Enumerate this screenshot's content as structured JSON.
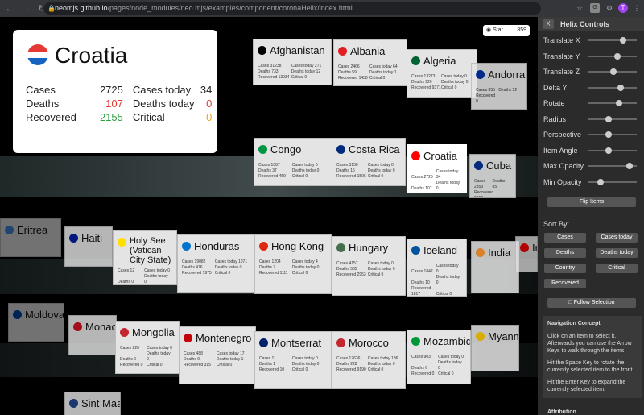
{
  "browser": {
    "host": "neomjs.github.io",
    "path": "/pages/node_modules/neo.mjs/examples/component/coronaHelix/index.html",
    "avatar": "T"
  },
  "github": {
    "label": "Star",
    "count": "859"
  },
  "selected": {
    "name": "Croatia",
    "cases_label": "Cases",
    "cases": "2725",
    "deaths_label": "Deaths",
    "deaths": "107",
    "recovered_label": "Recovered",
    "recovered": "2155",
    "cases_today_label": "Cases today",
    "cases_today": "34",
    "deaths_today_label": "Deaths today",
    "deaths_today": "0",
    "critical_label": "Critical",
    "critical": "0"
  },
  "cards": [
    {
      "name": "Afghanistan",
      "stats": [
        "Cases 31238",
        "Cases today 271",
        "Deaths 733",
        "Deaths today 12",
        "Recovered 13934",
        "Critical 0"
      ]
    },
    {
      "name": "Albania",
      "stats": [
        "Cases 2466",
        "Cases today 64",
        "Deaths 59",
        "Deaths today 1",
        "Recovered 1438",
        "Critical 0"
      ]
    },
    {
      "name": "Algeria",
      "stats": [
        "Cases 13273",
        "Cases today 0",
        "Deaths 920",
        "Deaths today 0",
        "Recovered 9371",
        "Critical 0"
      ]
    },
    {
      "name": "Andorra",
      "stats": [
        "Cases 855",
        "Deaths 52",
        "Recovered 0"
      ]
    },
    {
      "name": "Congo",
      "stats": [
        "Cases 1087",
        "Cases today 0",
        "Deaths 37",
        "Deaths today 0",
        "Recovered 459",
        "Critical 0"
      ]
    },
    {
      "name": "Costa Rica",
      "stats": [
        "Cases 3130",
        "Cases today 0",
        "Deaths 15",
        "Deaths today 0",
        "Recovered 1506",
        "Critical 0"
      ]
    },
    {
      "name": "Croatia",
      "stats": [
        "Cases 2725",
        "Cases today 34",
        "Deaths 107",
        "Deaths today 0",
        "Recovered 2155",
        "Critical 0"
      ]
    },
    {
      "name": "Cuba",
      "stats": [
        "Cases 2353",
        "Deaths 85",
        "Recovered 2150"
      ]
    },
    {
      "name": "Haiti",
      "stats": []
    },
    {
      "name": "Holy See (Vatican City State)",
      "stats": [
        "Cases 12",
        "Cases today 0",
        "Deaths 0",
        "Deaths today 0",
        "Recovered 12",
        "Critical 0"
      ]
    },
    {
      "name": "Honduras",
      "stats": [
        "Cases 19082",
        "Cases today 1071",
        "Deaths 476",
        "Deaths today 0",
        "Recovered 1975",
        "Critical 0"
      ]
    },
    {
      "name": "Hong Kong",
      "stats": [
        "Cases 1204",
        "Cases today 4",
        "Deaths 7",
        "Deaths today 0",
        "Recovered 1111",
        "Critical 0"
      ]
    },
    {
      "name": "Hungary",
      "stats": [
        "Cases 4157",
        "Cases today 0",
        "Deaths 585",
        "Deaths today 0",
        "Recovered 2953",
        "Critical 0"
      ]
    },
    {
      "name": "Iceland",
      "stats": [
        "Cases 1842",
        "Cases today 0",
        "Deaths 10",
        "Deaths today 0",
        "Recovered 1817",
        "Critical 0"
      ]
    },
    {
      "name": "India",
      "stats": []
    },
    {
      "name": "Indonesia",
      "stats": []
    },
    {
      "name": "Monaco",
      "stats": []
    },
    {
      "name": "Mongolia",
      "stats": [
        "Cases 220",
        "Cases today 0",
        "Deaths 0",
        "Deaths today 0",
        "Recovered 0",
        "Critical 0"
      ]
    },
    {
      "name": "Montenegro",
      "stats": [
        "Cases 488",
        "Cases today 17",
        "Deaths 9",
        "Deaths today 1",
        "Recovered 315",
        "Critical 0"
      ]
    },
    {
      "name": "Montserrat",
      "stats": [
        "Cases 11",
        "Cases today 0",
        "Deaths 1",
        "Deaths today 0",
        "Recovered 10",
        "Critical 0"
      ]
    },
    {
      "name": "Morocco",
      "stats": [
        "Cases 12636",
        "Cases today 186",
        "Deaths 228",
        "Deaths today 0",
        "Recovered 9190",
        "Critical 0"
      ]
    },
    {
      "name": "Mozambique",
      "stats": [
        "Cases 903",
        "Cases today 0",
        "Deaths 6",
        "Deaths today 0",
        "Recovered 0",
        "Critical 0"
      ]
    },
    {
      "name": "Myanmar",
      "stats": []
    },
    {
      "name": "Sint Maarten",
      "stats": []
    },
    {
      "name": "Moldova",
      "stats": []
    },
    {
      "name": "Eritrea",
      "stats": []
    }
  ],
  "panel": {
    "title": "Helix Controls",
    "close": "X",
    "sliders": [
      {
        "label": "Translate X",
        "value": 0.72
      },
      {
        "label": "Translate Y",
        "value": 0.6
      },
      {
        "label": "Translate Z",
        "value": 0.52
      },
      {
        "label": "Delta Y",
        "value": 0.67
      },
      {
        "label": "Rotate",
        "value": 0.64
      },
      {
        "label": "Radius",
        "value": 0.42
      },
      {
        "label": "Perspective",
        "value": 0.42
      },
      {
        "label": "Item Angle",
        "value": 0.42
      },
      {
        "label": "Max Opacity",
        "value": 0.85
      },
      {
        "label": "Min Opacity",
        "value": 0.27
      }
    ],
    "flip": "Flip Items",
    "sort_by": "Sort By:",
    "sort": [
      "Cases",
      "Cases today",
      "Deaths",
      "Deaths today",
      "Country",
      "Critical",
      "Recovered"
    ],
    "follow": "Follow Selection",
    "nav_title": "Navigation Concept",
    "nav_p1": "Click on an item to select it. Afterwards you can use the Arrow Keys to walk through the items.",
    "nav_p2": "Hit the Space Key to rotate the currently selected item to the front.",
    "nav_p3": "Hit the Enter Key to expand the currently selected item.",
    "attribution": "Attribution"
  }
}
